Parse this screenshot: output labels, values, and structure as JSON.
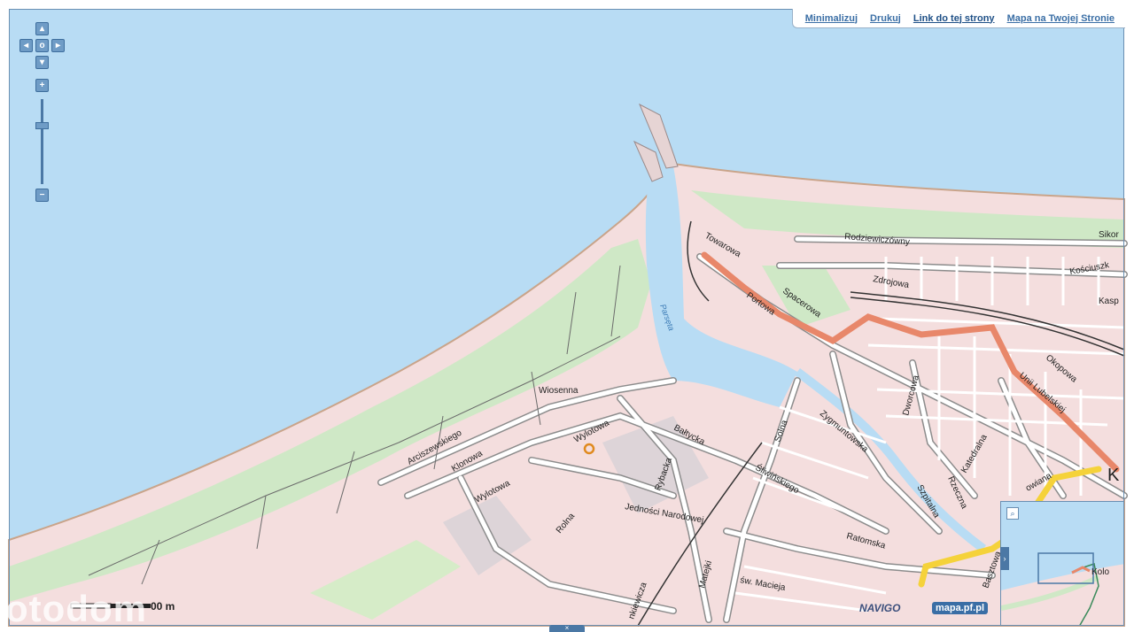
{
  "toolbar": {
    "minimize": "Minimalizuj",
    "print": "Drukuj",
    "link": "Link do tej strony",
    "embed": "Mapa na Twojej Stronie"
  },
  "nav": {
    "center": "o"
  },
  "scale": {
    "label": "00 m"
  },
  "watermark": "otodom",
  "brands": {
    "navigo": "NAVIGO",
    "mapa": "mapa.pf.pl"
  },
  "city_label": "K",
  "minimap": {
    "label": "Kolo"
  },
  "streets": {
    "wiosenna": "Wiosenna",
    "wylotowa1": "Wylotowa",
    "wylotowa2": "Wylotowa",
    "baltycka": "Bałtycka",
    "arciszewskiego": "Arciszewskiego",
    "klonowa": "Klonowa",
    "rolna": "Rolna",
    "rybacka": "Rybacka",
    "jednosci": "Jedności Narodowej",
    "sliwinskiego": "Śliwińskiego",
    "solna": "Solna",
    "zygmuntowska": "Zygmuntowska",
    "dworcowa": "Dworcowa",
    "towarowa": "Towarowa",
    "portowa": "Portowa",
    "spacerowa": "Spacerowa",
    "zdrojowa": "Zdrojowa",
    "rodziewiczowny": "Rodziewiczówny",
    "kosciuszki": "Kościuszk",
    "kasp": "Kasp",
    "sikor": "Sikor",
    "okopowa": "Okopowa",
    "unii": "Unii Lubelskiej",
    "katedralna": "Katedralna",
    "rzeczna": "Rzeczna",
    "szpitalna": "Szpitalna",
    "ratomska": "Ratomska",
    "swmaciej": "św. Macieja",
    "basztowa": "Basztowa",
    "matejki": "Matejki",
    "kiewicza": "nkiewicza",
    "owiana": "owiana",
    "river": "Parsęta"
  }
}
